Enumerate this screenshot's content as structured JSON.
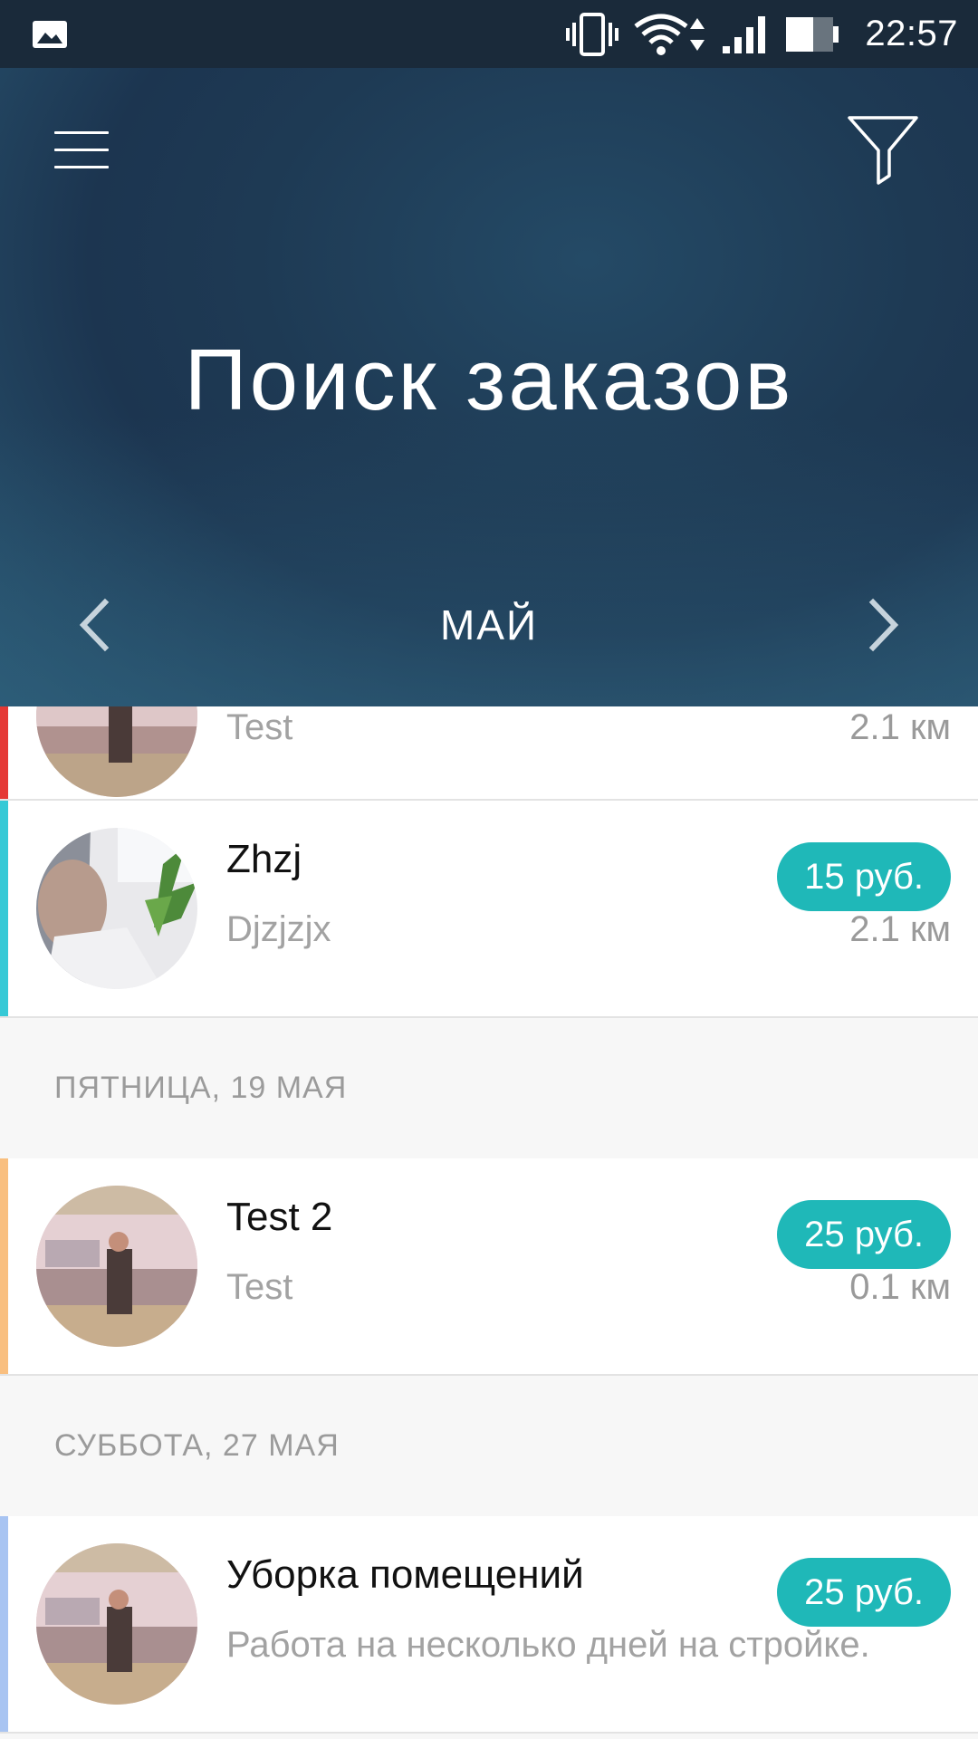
{
  "status_bar": {
    "time": "22:57",
    "icons": [
      "gallery-notification-icon",
      "vibrate-icon",
      "wifi-icon",
      "data-arrows-icon",
      "cell-signal-icon",
      "battery-icon"
    ]
  },
  "header": {
    "title": "Поиск заказов",
    "month": "МАЙ",
    "gradient_colors": [
      "#1c3550",
      "#2b5a76"
    ]
  },
  "colors": {
    "accent": "#1fb8b8",
    "stripe_red": "#e53935",
    "stripe_cyan": "#35c9d6",
    "stripe_orange": "#f9bf7f",
    "stripe_blue": "#a8c4f2"
  },
  "orders": [
    {
      "title": "",
      "description": "Test",
      "distance": "2.1 км",
      "price": "",
      "stripe": "red"
    },
    {
      "title": "Zhzj",
      "description": "Djzjzjx",
      "distance": "2.1 км",
      "price": "15 руб.",
      "stripe": "cyan"
    },
    {
      "title": "Test 2",
      "description": "Test",
      "distance": "0.1 км",
      "price": "25 руб.",
      "stripe": "orange"
    },
    {
      "title": "Уборка помещений",
      "description": "Работа на несколько дней на стройке.",
      "distance": "",
      "price": "25 руб.",
      "stripe": "blue"
    }
  ],
  "sections": [
    {
      "label": "ПЯТНИЦА, 19 МАЯ"
    },
    {
      "label": "СУББОТА, 27 МАЯ"
    }
  ]
}
